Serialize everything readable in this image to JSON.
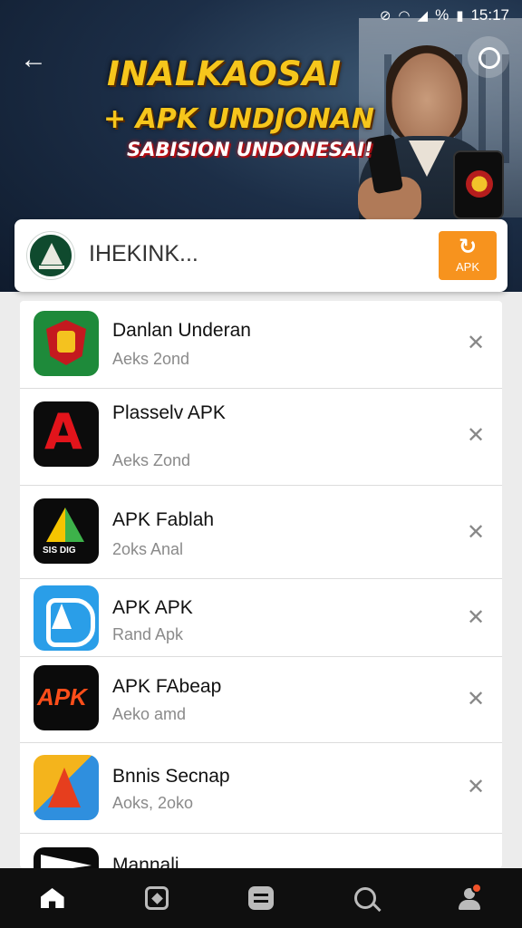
{
  "status_bar": {
    "battery": "%",
    "time": "15:17"
  },
  "banner": {
    "title": "INALKAOSAI",
    "subtitle": "+ APK UNDJONAN",
    "tag": "SABISION UNDONESAI!"
  },
  "search": {
    "value": "IHEKINK...",
    "apk_button_label": "APK"
  },
  "list": [
    {
      "title": "Danlan Underan",
      "subtitle": "Aeks 2ond"
    },
    {
      "title": "Plasselv APK",
      "subtitle": "Aeks Zond"
    },
    {
      "title": "APK Fablah",
      "subtitle": "2oks Anal"
    },
    {
      "title": "APK APK",
      "subtitle": "Rand Apk"
    },
    {
      "title": "APK FAbeap",
      "subtitle": "Aeko amd",
      "icon_text": "APK"
    },
    {
      "title": "Bnnis Secnap",
      "subtitle": "Aoks, 2oko"
    },
    {
      "title": "Mannali",
      "subtitle": ""
    }
  ],
  "colors": {
    "accent": "#f7931e",
    "banner_text": "#f6c61c"
  }
}
